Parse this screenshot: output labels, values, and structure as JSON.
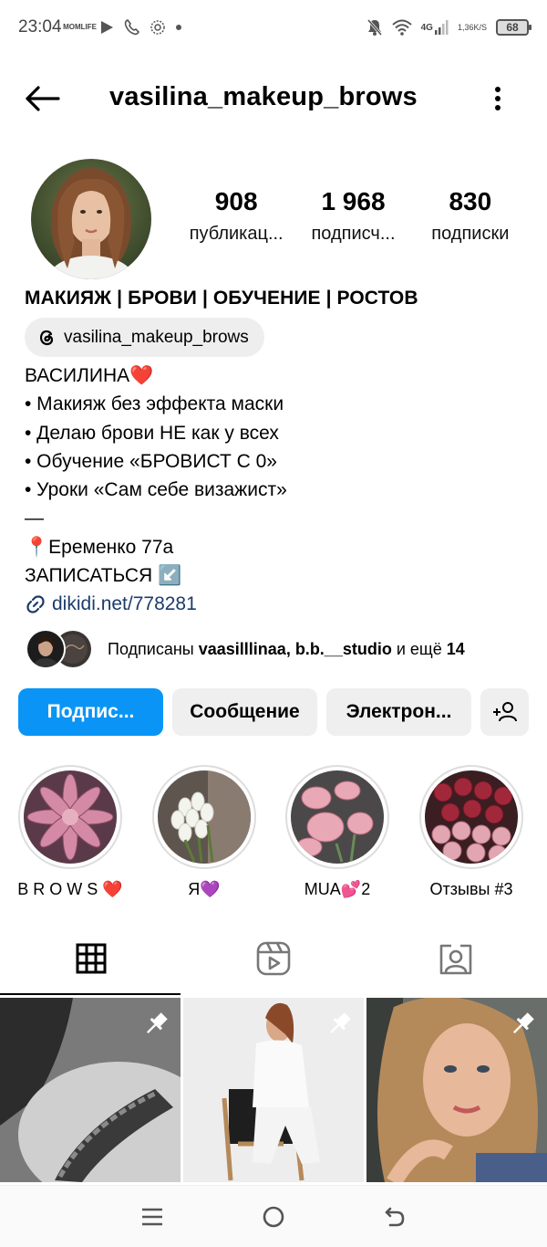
{
  "status_bar": {
    "time": "23:04",
    "momlife_line1": "MOM",
    "momlife_line2": "LIFE",
    "network": "4G",
    "speed_value": "1,36",
    "speed_unit": "K/S",
    "battery": "68"
  },
  "header": {
    "username": "vasilina_makeup_brows"
  },
  "stats": [
    {
      "value": "908",
      "label": "публикац..."
    },
    {
      "value": "1 968",
      "label": "подписч..."
    },
    {
      "value": "830",
      "label": "подписки"
    }
  ],
  "bio": {
    "category_line": "МАКИЯЖ | БРОВИ | ОБУЧЕНИЕ | РОСТОВ",
    "threads_handle": "vasilina_makeup_brows",
    "name": "ВАСИЛИНА",
    "name_emoji": "❤️",
    "lines": [
      "• Макияж без эффекта маски",
      "• Делаю брови НЕ как у всех",
      "• Обучение «БРОВИСТ С 0»",
      "• Уроки «Сам себе визажист»",
      "—"
    ],
    "address_pin": "📍",
    "address": "Еременко 77а",
    "cta": "ЗАПИСАТЬСЯ",
    "cta_emoji": "↙️",
    "link": "dikidi.net/778281"
  },
  "followed_by": {
    "prefix": "Подписаны ",
    "names": "vaasilllinaa, b.b.__studio",
    "middle": " и ещё ",
    "count": "14"
  },
  "actions": {
    "follow": "Подпис...",
    "message": "Сообщение",
    "email": "Электрон..."
  },
  "highlights": [
    {
      "label": "B R O W S ❤️"
    },
    {
      "label": "Я💜"
    },
    {
      "label": "MUA💕2"
    },
    {
      "label": "Отзывы #3"
    }
  ],
  "tabs": [
    {
      "icon": "grid-icon",
      "active": true
    },
    {
      "icon": "reels-icon",
      "active": false
    },
    {
      "icon": "tagged-icon",
      "active": false
    }
  ],
  "colors": {
    "primary_button": "#0a95f6",
    "grey_button": "#efefef",
    "link": "#1b3c6b"
  }
}
